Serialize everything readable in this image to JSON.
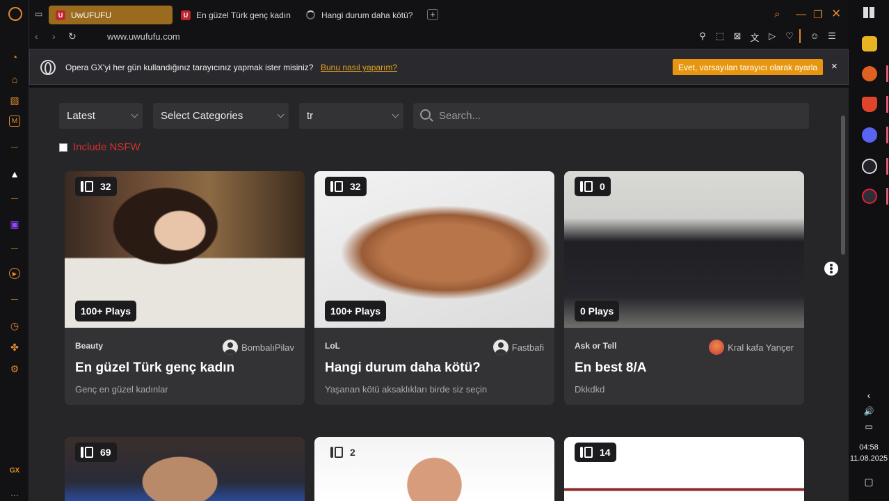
{
  "tabs": [
    {
      "label": "UwUFUFU",
      "icon": "U",
      "active": true
    },
    {
      "label": "En güzel Türk genç kadın",
      "icon": "U",
      "active": false
    },
    {
      "label": "Hangi durum daha kötü?",
      "icon": "loading-spinner",
      "active": false
    }
  ],
  "address": {
    "url": "www.uwufufu.com"
  },
  "notification": {
    "text": "Opera GX'yi her gün kullandığınız tarayıcınız yapmak ister misiniz?",
    "link": "Bunu nasıl yaparım?",
    "button": "Evet, varsayılan tarayıcı olarak ayarla",
    "close": "×"
  },
  "filters": {
    "sort": "Latest",
    "categories": "Select Categories",
    "language": "tr",
    "search_placeholder": "Search...",
    "nsfw_label": "Include NSFW"
  },
  "cards": [
    {
      "count": "32",
      "plays": "100+ Plays",
      "category": "Beauty",
      "user": "BombalıPilav",
      "title": "En güzel Türk genç kadın",
      "desc": "Genç en güzel kadınlar"
    },
    {
      "count": "32",
      "plays": "100+ Plays",
      "category": "LoL",
      "user": "Fastbafi",
      "title": "Hangi durum daha kötü?",
      "desc": "Yaşanan kötü aksaklıkları birde siz seçin"
    },
    {
      "count": "0",
      "plays": "0 Plays",
      "category": "Ask or Tell",
      "user": "Kral kafa Yançer",
      "title": "En best 8/A",
      "desc": "Dkkdkd"
    },
    {
      "count": "69"
    },
    {
      "count": "2"
    },
    {
      "count": "14"
    }
  ],
  "sidebar_badge": "GX",
  "sidebar_more": "...",
  "system": {
    "time": "04:58",
    "date": "11.08.2025"
  },
  "colors": {
    "accent": "#e08a2c",
    "nsfw": "#d4322f",
    "button": "#e8960f"
  }
}
